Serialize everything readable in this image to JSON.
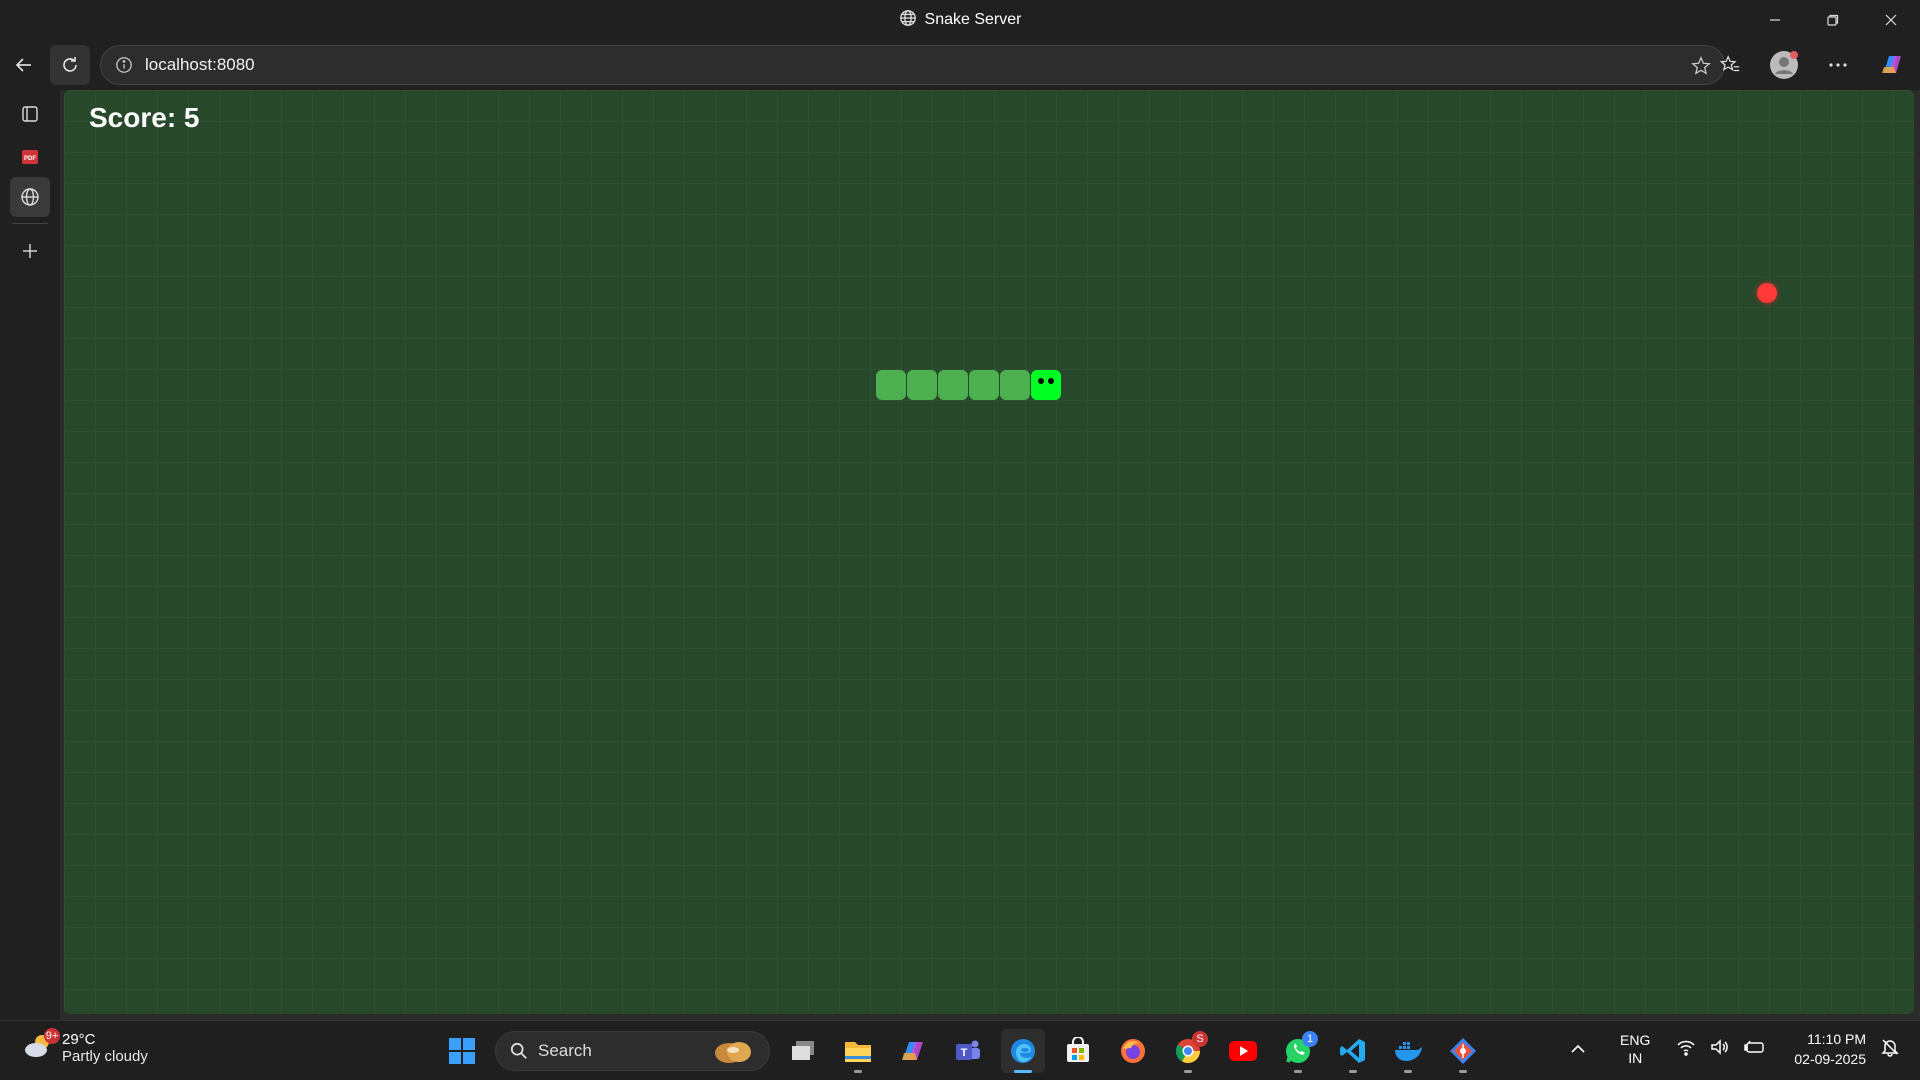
{
  "window": {
    "title": "Snake Server"
  },
  "address_bar": {
    "url": "localhost:8080"
  },
  "game": {
    "score_text": "Score: 5",
    "snake_length": 6,
    "head_direction": "right"
  },
  "taskbar": {
    "weather": {
      "temp": "29°C",
      "condition": "Partly cloudy",
      "badge": "9+"
    },
    "search_placeholder": "Search",
    "chrome_badge": "S",
    "whatsapp_badge": "1",
    "language": {
      "line1": "ENG",
      "line2": "IN"
    },
    "clock": {
      "time": "11:10 PM",
      "date": "02-09-2025"
    }
  },
  "colors": {
    "board": "#27482a",
    "snake_body": "#4caf50",
    "snake_head": "#00ff22",
    "food": "#ff3838"
  }
}
